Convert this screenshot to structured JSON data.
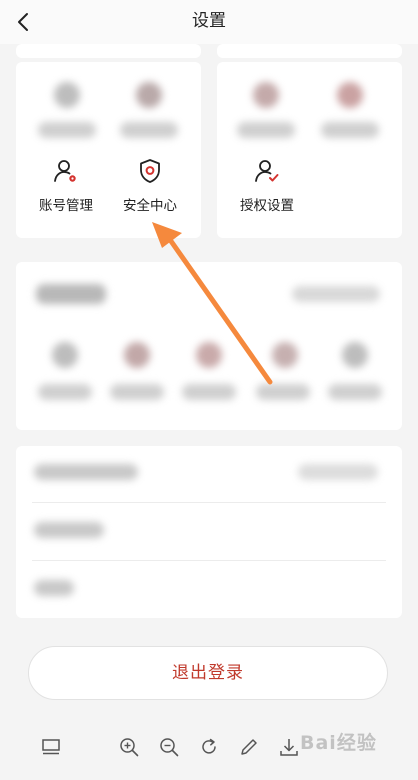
{
  "header": {
    "title": "设置"
  },
  "grid": {
    "items": [
      {
        "label": "账号管理",
        "icon": "account-manage-icon"
      },
      {
        "label": "安全中心",
        "icon": "security-center-icon"
      },
      {
        "label": "授权设置",
        "icon": "authorization-icon"
      }
    ]
  },
  "logout": {
    "label": "退出登录"
  },
  "watermark": {
    "text": "Bai经验"
  },
  "colors": {
    "accent": "#d4332f",
    "arrow": "#f5893d"
  }
}
